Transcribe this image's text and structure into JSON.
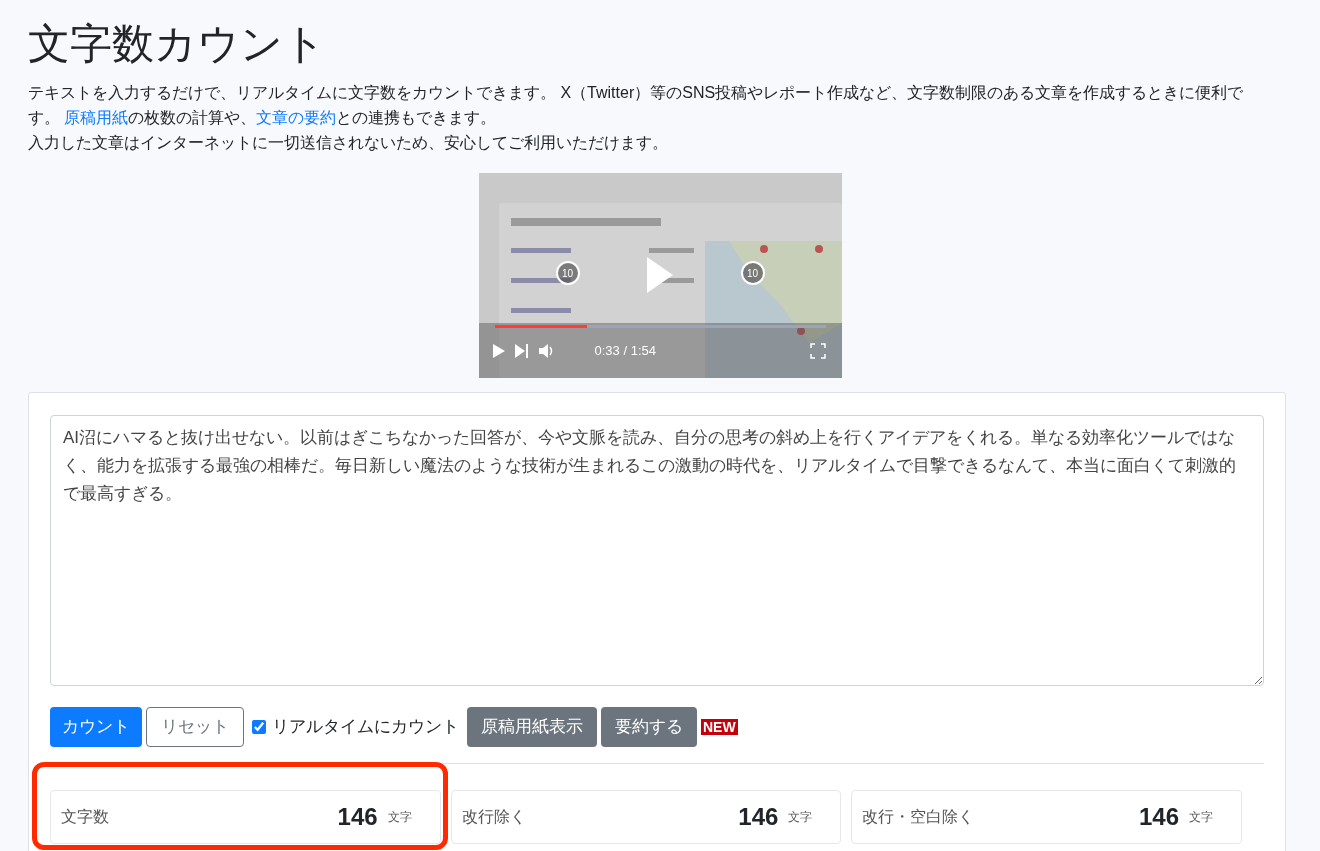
{
  "title": "文字数カウント",
  "description": {
    "lines": [
      {
        "parts": [
          {
            "kind": "text",
            "text": "テキストを入力するだけで、リアルタイムに文字数をカウントできます。 X（Twitter）等のSNS投稿やレポート作成など、文字数制限のある文章を作成するときに便利です。 "
          },
          {
            "kind": "link",
            "text": "原稿用紙"
          },
          {
            "kind": "text",
            "text": "の枚数の計算や、"
          },
          {
            "kind": "link",
            "text": "文章の要約"
          },
          {
            "kind": "text",
            "text": "との連携もできます。"
          }
        ]
      },
      {
        "parts": [
          {
            "kind": "text",
            "text": "入力した文章はインターネットに一切送信されないため、安心してご利用いただけます。"
          }
        ]
      }
    ]
  },
  "video": {
    "kind": "picture",
    "time": "0:33",
    "separator": "/",
    "duration": "1:54",
    "level": 0.28,
    "rewind_label": "10",
    "forward_label": "10"
  },
  "editor": {
    "value": "AI沼にハマると抜け出せない。以前はぎこちなかった回答が、今や文脈を読み、自分の思考の斜め上を行くアイデアをくれる。単なる効率化ツールではなく、能力を拡張する最強の相棒だ。毎日新しい魔法のような技術が生まれるこの激動の時代を、リアルタイムで目撃できるなんて、本当に面白くて刺激的で最高すぎる。"
  },
  "toolbar": [
    {
      "kind": "primary",
      "label": "カウント"
    },
    {
      "kind": "outline",
      "label": "リセット"
    },
    {
      "kind": "checkbox",
      "label": "リアルタイムにカウント",
      "checked": true
    },
    {
      "kind": "secondary",
      "label": "原稿用紙表示"
    },
    {
      "kind": "secondary",
      "label": "要約する"
    },
    {
      "kind": "badge",
      "label": "NEW"
    }
  ],
  "stats": [
    {
      "label": "文字数",
      "value": "146",
      "unit": "文字",
      "highlighted": true
    },
    {
      "label": "改行除く",
      "value": "146",
      "unit": "文字",
      "highlighted": false
    },
    {
      "label": "改行・空白除く",
      "value": "146",
      "unit": "文字",
      "highlighted": false
    }
  ]
}
